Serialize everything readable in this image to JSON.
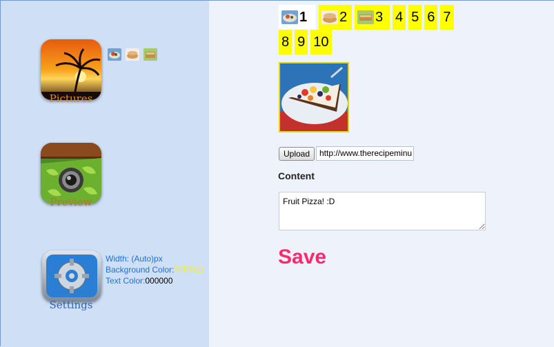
{
  "sidebar": {
    "pictures_label": "Pictures",
    "preview_label": "Preview",
    "settings_label": "Settings",
    "settings_info": {
      "width_label": "Width: (Auto)px",
      "bg_label": "Background Color:",
      "bg_value": "FFFF00",
      "text_color_label": "Text Color:",
      "text_color_value": "000000"
    }
  },
  "main": {
    "pages_row1": [
      "1",
      "2",
      "3",
      "4",
      "5",
      "6",
      "7"
    ],
    "pages_row2": [
      "8",
      "9",
      "10"
    ],
    "upload_label": "Upload",
    "url_value": "http://www.therecipeminu",
    "content_label": "Content",
    "content_value": "Fruit Pizza! :D",
    "save_label": "Save"
  },
  "colors": {
    "accent_yellow": "#FFFF00",
    "save_pink": "#FF2A6D",
    "link_blue": "#1F6FD6"
  }
}
